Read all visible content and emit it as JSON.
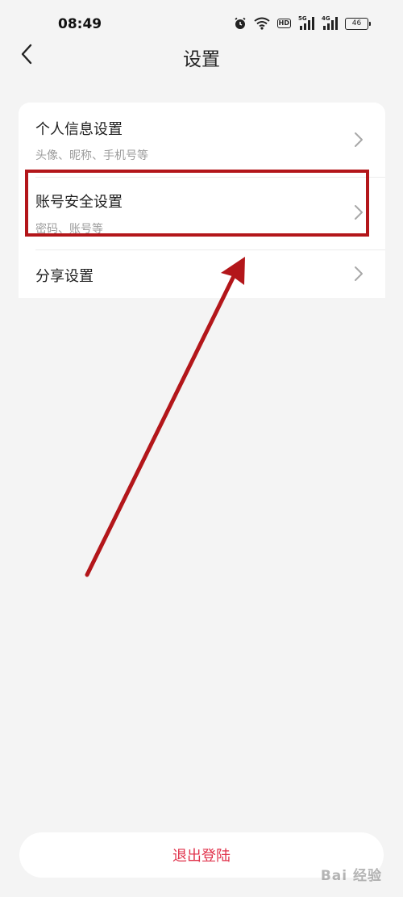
{
  "status_bar": {
    "time": "08:49",
    "icons": [
      "alarm-icon",
      "wifi-icon",
      "hd-icon",
      "5g-signal-icon",
      "4g-signal-icon",
      "battery-icon"
    ],
    "hd_label": "HD",
    "network_5g": "5G",
    "network_4g": "4G",
    "battery_level": "46"
  },
  "header": {
    "title": "设置",
    "back_icon": "chevron-left-icon"
  },
  "settings": {
    "items": [
      {
        "title": "个人信息设置",
        "subtitle": "头像、昵称、手机号等"
      },
      {
        "title": "账号安全设置",
        "subtitle": "密码、账号等"
      },
      {
        "title": "分享设置"
      }
    ]
  },
  "footer": {
    "logout_label": "退出登陆"
  },
  "watermark": {
    "text": "Bai 经验"
  },
  "colors": {
    "background": "#f4f4f4",
    "card": "#ffffff",
    "logout_text": "#e0324b",
    "annotation": "#b3161a"
  }
}
